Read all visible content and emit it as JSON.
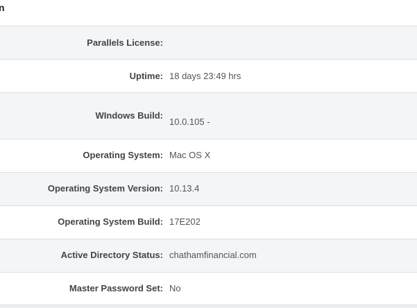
{
  "header": {
    "title_fragment": "n"
  },
  "details": [
    {
      "label": "Parallels License:",
      "value": ""
    },
    {
      "label": "Uptime:",
      "value": "18 days 23:49 hrs"
    },
    {
      "label": "WIndows Build:",
      "value": "10.0.105 -"
    },
    {
      "label": "Operating System:",
      "value": "Mac OS X"
    },
    {
      "label": "Operating System Version:",
      "value": "10.13.4"
    },
    {
      "label": "Operating System Build:",
      "value": "17E202"
    },
    {
      "label": "Active Directory Status:",
      "value": "chathamfinancial.com"
    },
    {
      "label": "Master Password Set:",
      "value": "No"
    }
  ]
}
